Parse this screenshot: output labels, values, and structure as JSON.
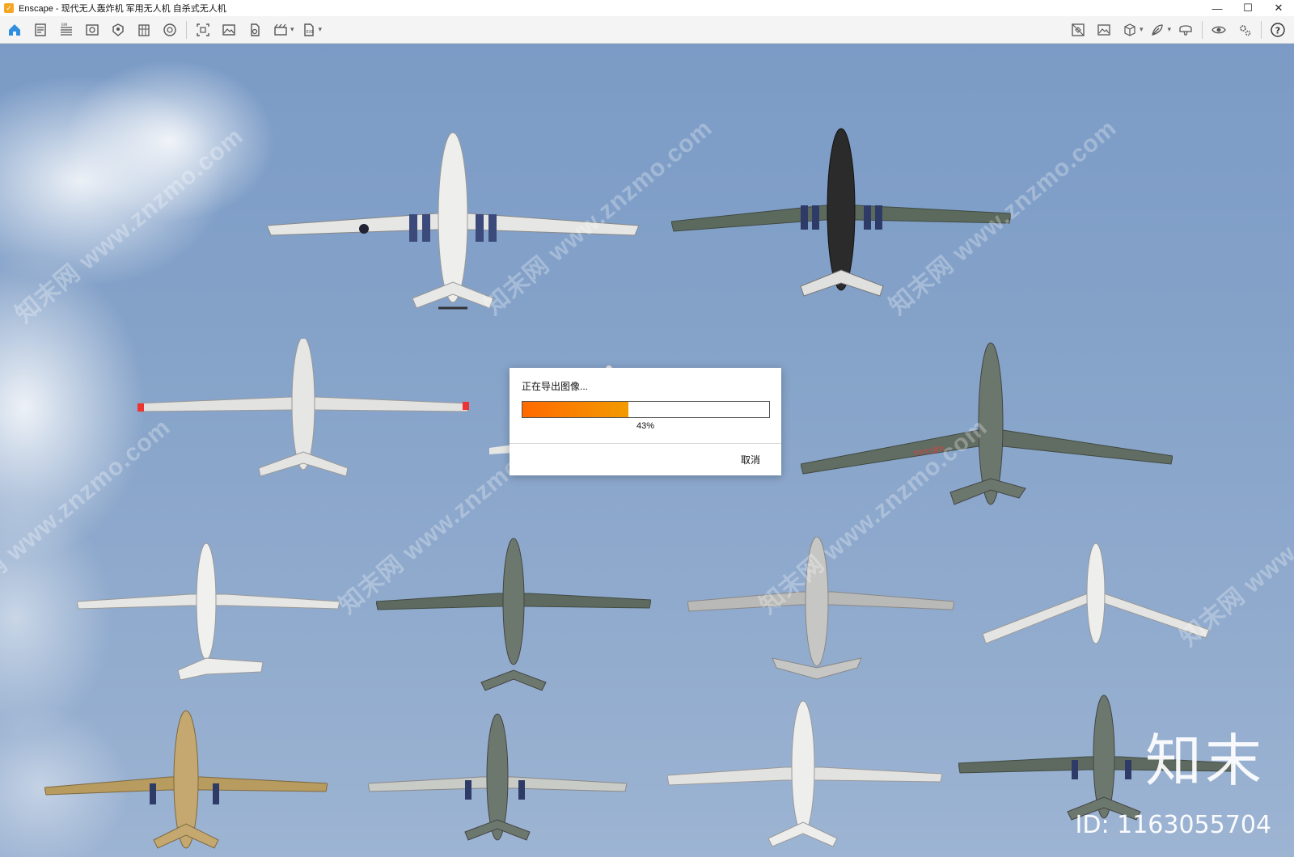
{
  "window": {
    "title": "Enscape - 现代无人轰炸机 军用无人机 自杀式无人机",
    "app_icon": "enscape-logo-icon",
    "controls": [
      "minimize-icon",
      "maximize-icon",
      "close-icon"
    ]
  },
  "toolbar": {
    "left_tools": [
      "home-icon",
      "project-icon",
      "bim-icon",
      "view-icon",
      "asset-icon",
      "layers-icon",
      "materials-icon",
      "screenshot-icon",
      "image-icon",
      "panorama-icon",
      "video-icon",
      "export-icon"
    ],
    "right_tools": [
      "map-icon",
      "gallery-icon",
      "cube-icon",
      "feather-icon",
      "vr-icon",
      "eye-icon",
      "settings-icon",
      "help-icon"
    ],
    "collapse": "chevron-up-icon"
  },
  "export_dialog": {
    "title": "正在导出图像...",
    "progress": 0.43,
    "progress_text": "43%",
    "cancel_label": "取消"
  },
  "watermark": {
    "text": "知末网 www.znzmo.com",
    "brand": "知末",
    "id_text": "ID: 1163055704"
  },
  "colors": {
    "sky": "#86a3c9",
    "progress_start": "#ff6a00",
    "progress_end": "#f39a00",
    "app_icon": "#f5a623"
  }
}
